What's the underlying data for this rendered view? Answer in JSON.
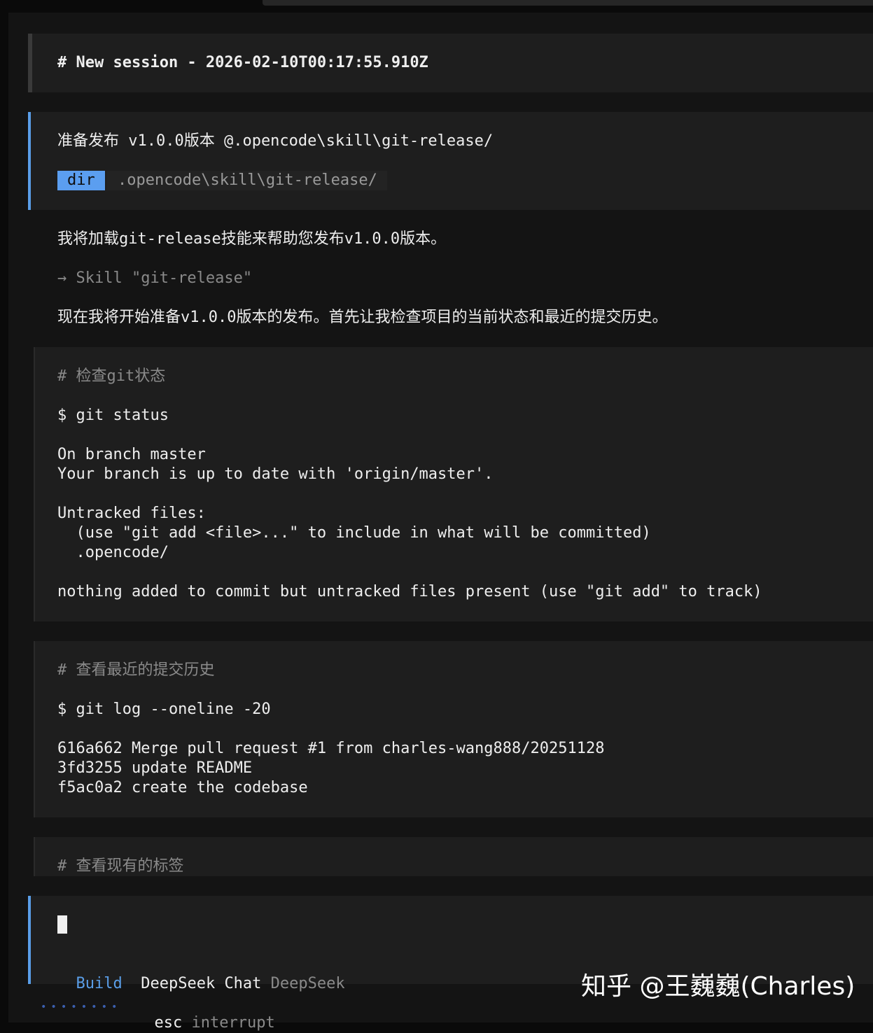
{
  "session": {
    "title": "# New session - 2026-02-10T00:17:55.910Z"
  },
  "user_message": {
    "text": "准备发布 v1.0.0版本 @.opencode\\skill\\git-release/",
    "badge": "dir",
    "path": ".opencode\\skill\\git-release/"
  },
  "assistant": {
    "intro": "我将加载git-release技能来帮助您发布v1.0.0版本。",
    "skill_call": "→ Skill \"git-release\"",
    "next": "现在我将开始准备v1.0.0版本的发布。首先让我检查项目的当前状态和最近的提交历史。"
  },
  "tool_blocks": [
    {
      "comment": "# 检查git状态",
      "command": "$ git status",
      "output": [
        "On branch master",
        "Your branch is up to date with 'origin/master'.",
        "",
        "Untracked files:",
        "  (use \"git add <file>...\" to include in what will be committed)",
        "  .opencode/",
        "",
        "nothing added to commit but untracked files present (use \"git add\" to track)"
      ]
    },
    {
      "comment": "# 查看最近的提交历史",
      "command": "$ git log --oneline -20",
      "output": [
        "616a662 Merge pull request #1 from charles-wang888/20251128",
        "3fd3255 update README",
        "f5ac0a2 create the codebase"
      ]
    },
    {
      "comment": "# 查看现有的标签"
    }
  ],
  "input": {
    "mode": "Build",
    "model": "DeepSeek Chat",
    "provider": "DeepSeek"
  },
  "footer": {
    "progress_dots": "••••••••",
    "key": "esc",
    "action": "interrupt"
  },
  "watermark": "知乎 @王巍巍(Charles)",
  "colors": {
    "accent": "#5a9ee8",
    "background": "#141414",
    "panel": "#1e1e1e",
    "muted": "#8a8a8a"
  }
}
